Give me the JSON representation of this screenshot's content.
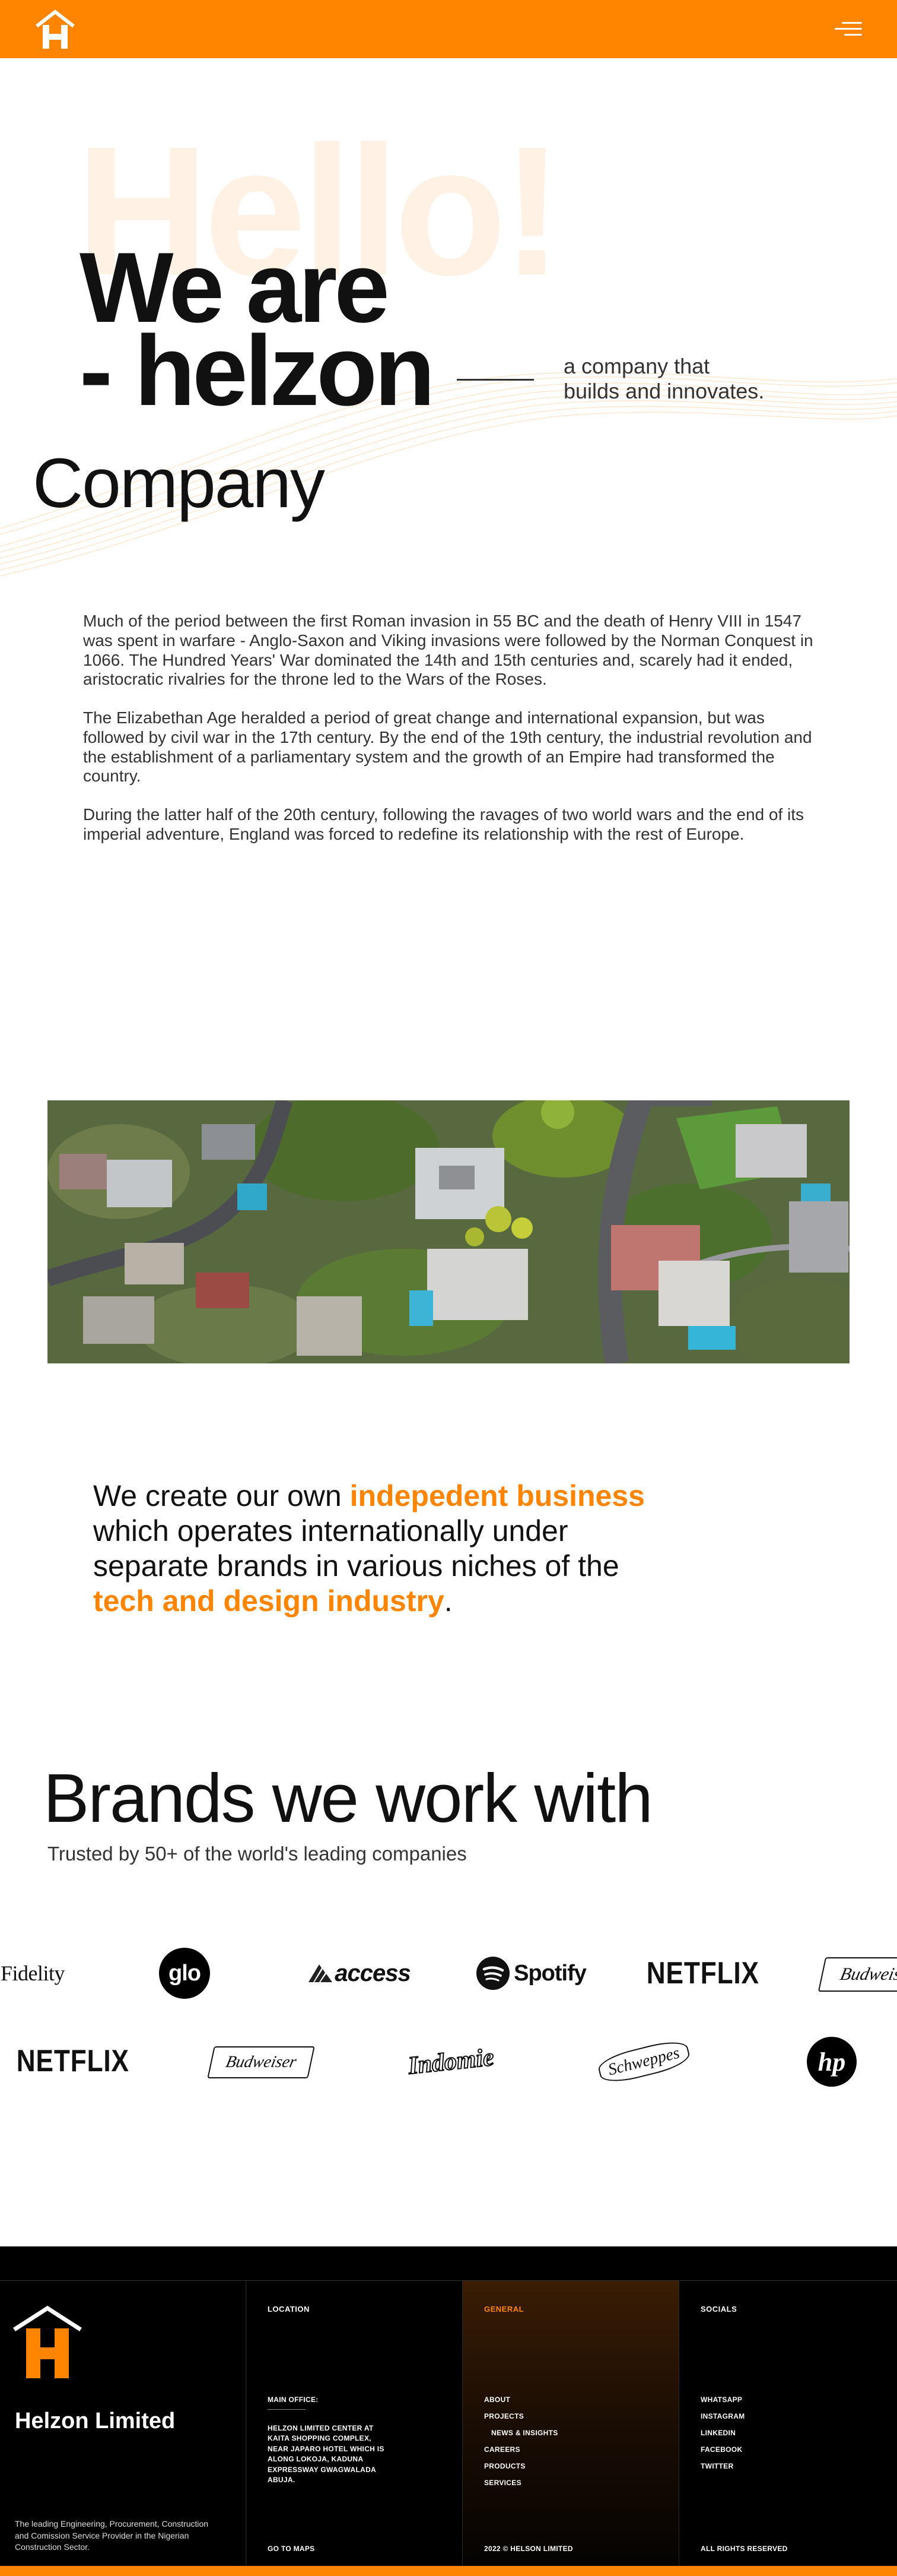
{
  "header": {
    "logo_name": "helzon-house-logo",
    "menu_icon": "hamburger-menu-icon",
    "brand_color": "#ff8500"
  },
  "hero": {
    "background_word": "Hello!",
    "line1": "We are",
    "line2": "- helzon",
    "tagline_line1": "a company that",
    "tagline_line2": "builds and innovates.",
    "company_word": "Company"
  },
  "about": {
    "paragraphs": [
      "Much of the period between the first Roman invasion in 55 BC and the death of Henry VIII in 1547 was spent in warfare - Anglo-Saxon and Viking invasions were followed by the Norman Conquest in 1066. The Hundred Years' War dominated the 14th and 15th centuries and, scarely had it ended, aristocratic rivalries for the throne led to the Wars of the Roses.",
      "The Elizabethan Age heralded a period of great change and international expansion, but was followed by civil war in the 17th century. By the end of the 19th century, the industrial revolution and the establishment of a parliamentary system and the growth of an Empire had transformed the country.",
      "During the latter half of the 20th century, following the ravages of two world wars and the end of its imperial adventure, England was forced to redefine its relationship with the rest of Europe."
    ]
  },
  "statement": {
    "p1": "We create our own ",
    "h1": "indepedent business",
    "p2": " which operates internationally under separate brands in various niches of the ",
    "h2": "tech and design industry",
    "p3": "."
  },
  "brands": {
    "title": "Brands we work with",
    "subtitle": "Trusted by 50+ of the world's leading companies",
    "row1": [
      "Fidelity",
      "glo",
      "access",
      "Spotify",
      "NETFLIX",
      "Budweiser"
    ],
    "row2": [
      "NETFLIX",
      "Budweiser",
      "Indomie",
      "Schweppes",
      "hp"
    ]
  },
  "footer": {
    "company_name": "Helzon Limited",
    "company_desc": "The leading Engineering, Procurement, Construction and Comission Service Provider in the Nigerian Construction Sector.",
    "location": {
      "heading": "LOCATION",
      "office_label": "MAIN OFFICE:",
      "address": "HELZON LIMITED CENTER AT KAITA SHOPPING COMPLEX, NEAR JAPARO HOTEL WHICH IS ALONG LOKOJA, KADUNA EXPRESSWAY GWAGWALADA ABUJA.",
      "maps_link": "GO TO MAPS"
    },
    "general": {
      "heading": "GENERAL",
      "links": [
        "ABOUT",
        "PROJECTS",
        "NEWS & INSIGHTS",
        "CAREERS",
        "PRODUCTS",
        "SERVICES"
      ],
      "copyright": "2022 © HELSON LIMITED"
    },
    "socials": {
      "heading": "SOCIALS",
      "links": [
        "WHATSAPP",
        "INSTAGRAM",
        "LINKEDIN",
        "FACEBOOK",
        "TWITTER"
      ],
      "rights": "ALL RIGHTS RESERVED"
    }
  }
}
